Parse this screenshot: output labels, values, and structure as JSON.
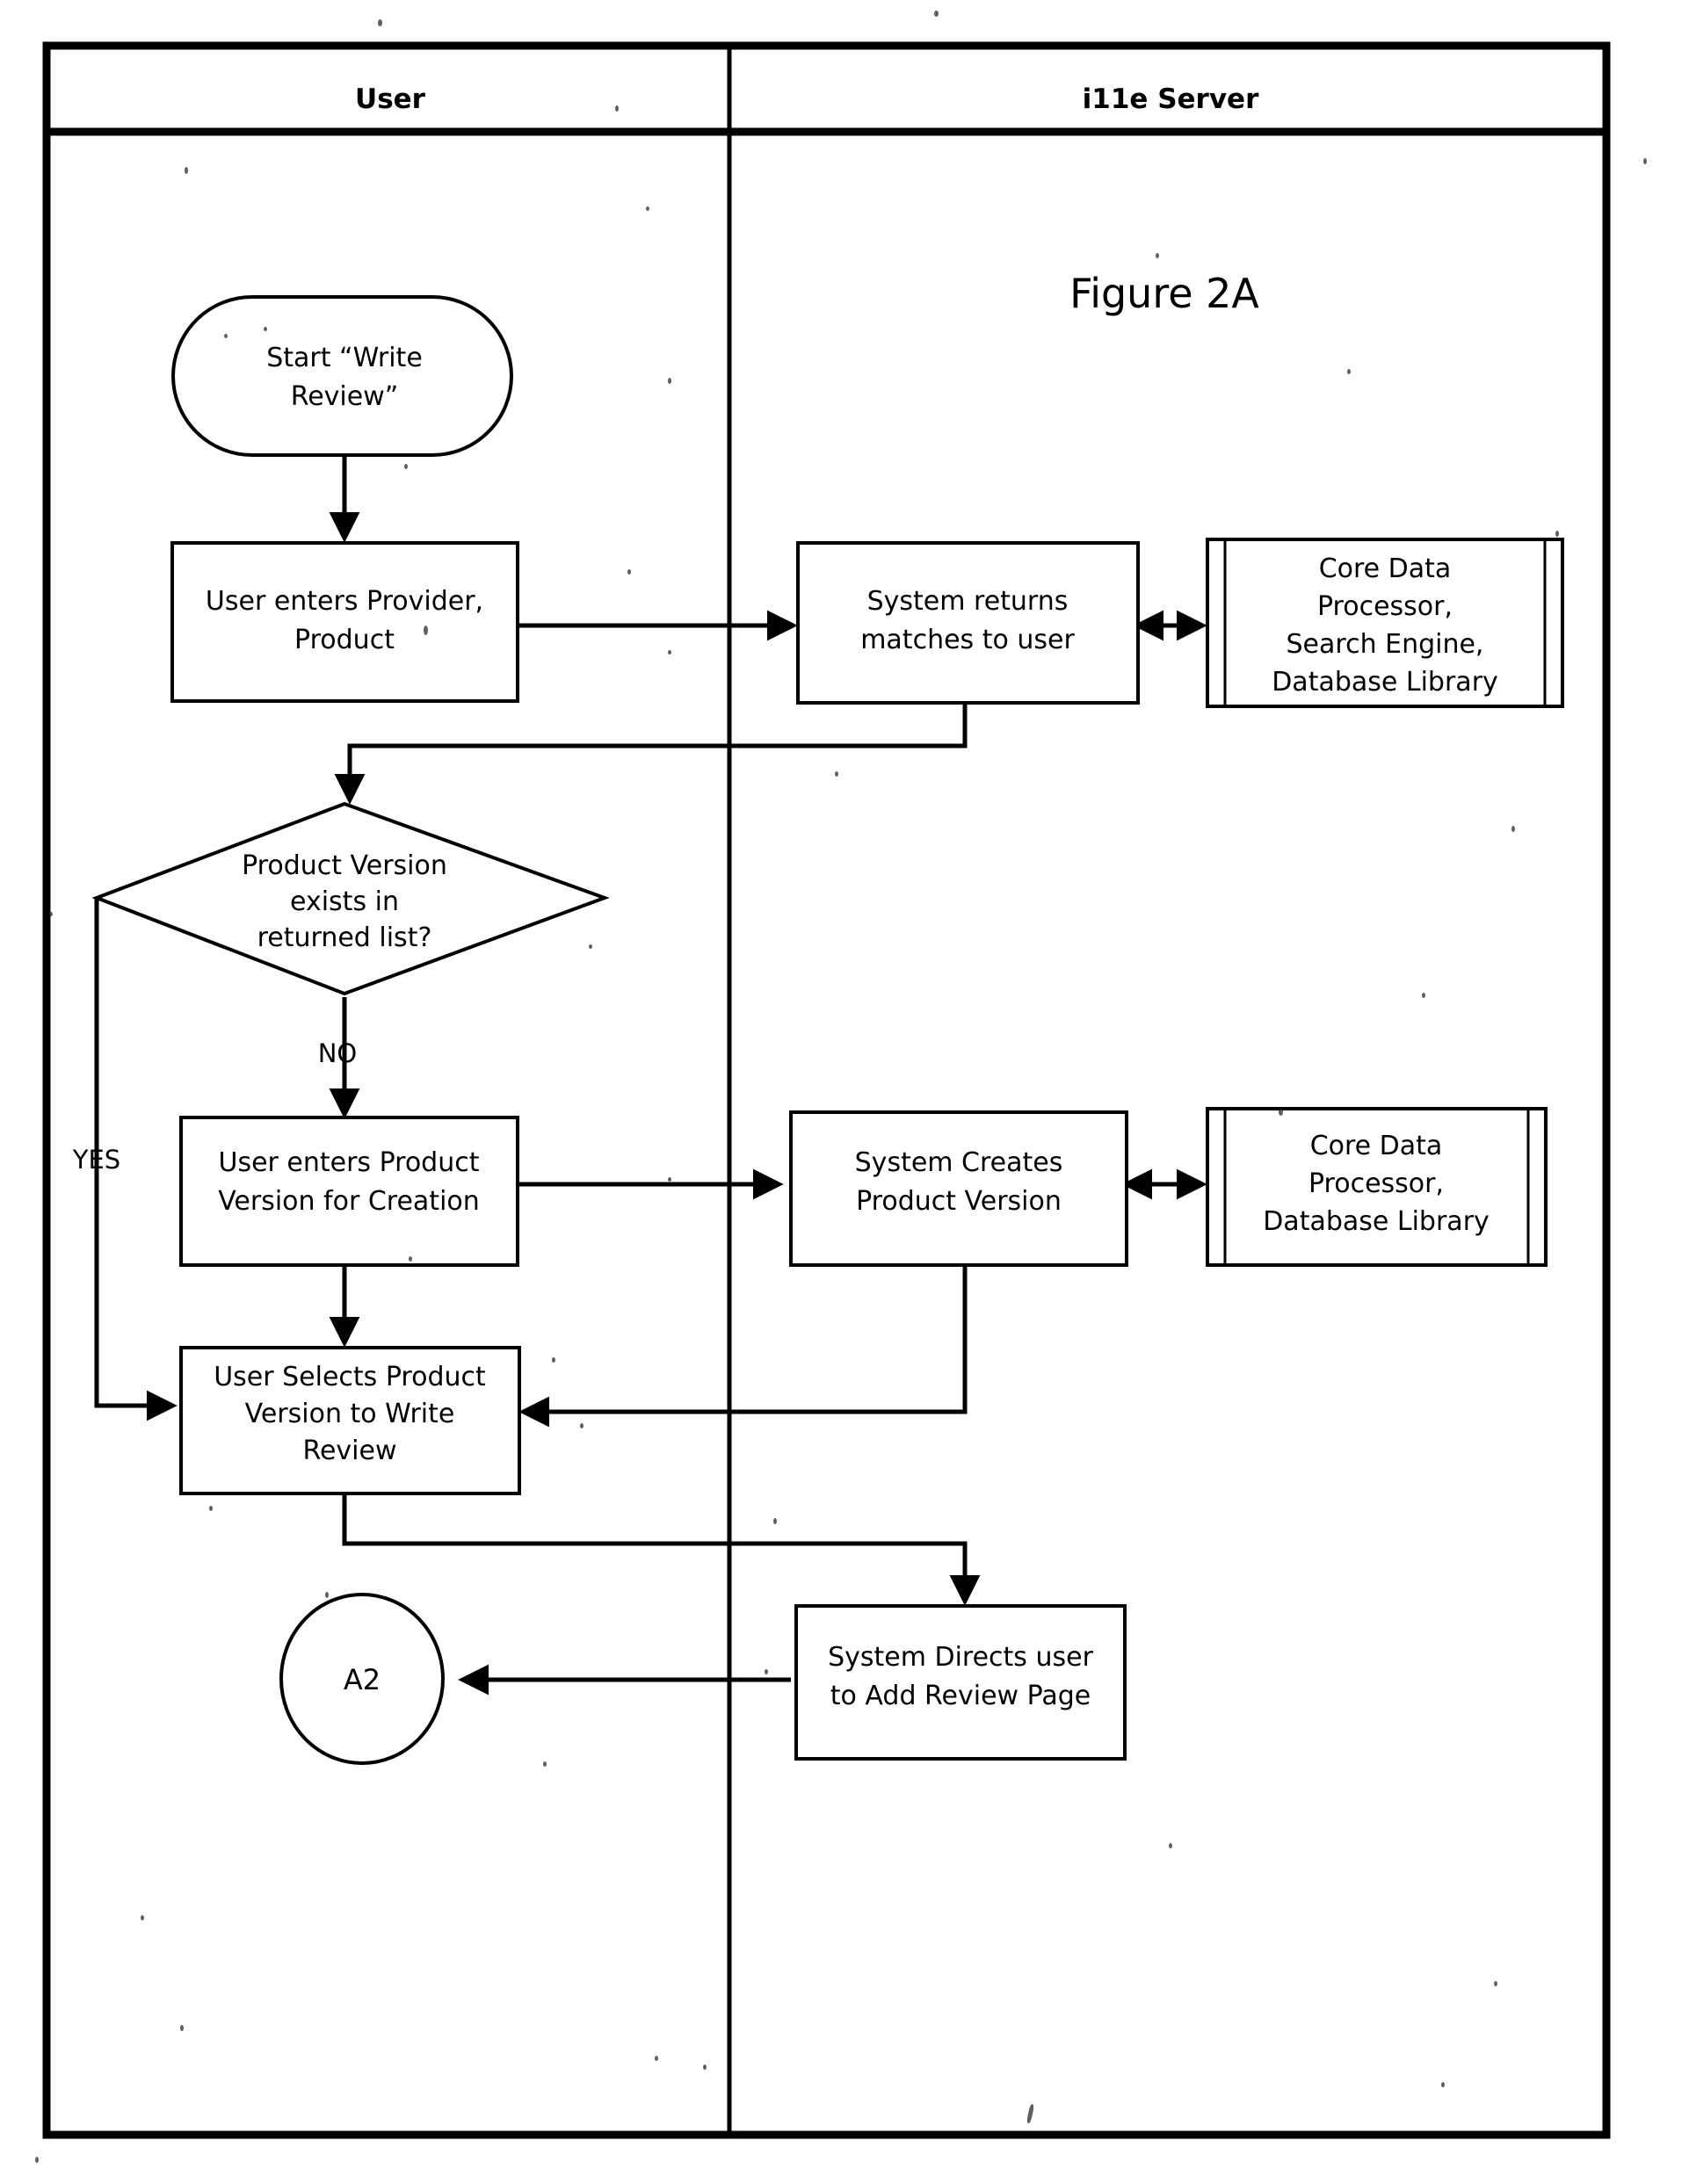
{
  "figure": {
    "title": "Figure 2A"
  },
  "lanes": [
    {
      "id": "user",
      "label": "User"
    },
    {
      "id": "server",
      "label": "i11e Server"
    }
  ],
  "nodes": {
    "start": {
      "shape": "terminator",
      "lane": "user",
      "lines": [
        "Start “Write",
        "Review”"
      ]
    },
    "enter_provider": {
      "shape": "process",
      "lane": "user",
      "lines": [
        "User enters Provider,",
        "Product"
      ]
    },
    "system_returns": {
      "shape": "process",
      "lane": "server",
      "lines": [
        "System returns",
        "matches to user"
      ]
    },
    "core_data_1": {
      "shape": "subroutine",
      "lane": "server",
      "lines": [
        "Core Data",
        "Processor,",
        "Search Engine,",
        "Database Library"
      ]
    },
    "version_exists": {
      "shape": "decision",
      "lane": "user",
      "lines": [
        "Product Version",
        "exists in",
        "returned list?"
      ]
    },
    "enter_version": {
      "shape": "process",
      "lane": "user",
      "lines": [
        "User enters Product",
        "Version for Creation"
      ]
    },
    "system_creates": {
      "shape": "process",
      "lane": "server",
      "lines": [
        "System Creates",
        "Product Version"
      ]
    },
    "core_data_2": {
      "shape": "subroutine",
      "lane": "server",
      "lines": [
        "Core Data",
        "Processor,",
        "Database Library"
      ]
    },
    "select_version": {
      "shape": "process",
      "lane": "user",
      "lines": [
        "User Selects Product",
        "Version to Write",
        "Review"
      ]
    },
    "system_directs": {
      "shape": "process",
      "lane": "server",
      "lines": [
        "System Directs user",
        "to Add Review Page"
      ]
    },
    "connector_a2": {
      "shape": "connector",
      "lane": "user",
      "lines": [
        "A2"
      ]
    }
  },
  "edge_labels": {
    "yes": "YES",
    "no": "NO"
  },
  "colors": {
    "ink": "#000000",
    "paper": "#ffffff"
  }
}
